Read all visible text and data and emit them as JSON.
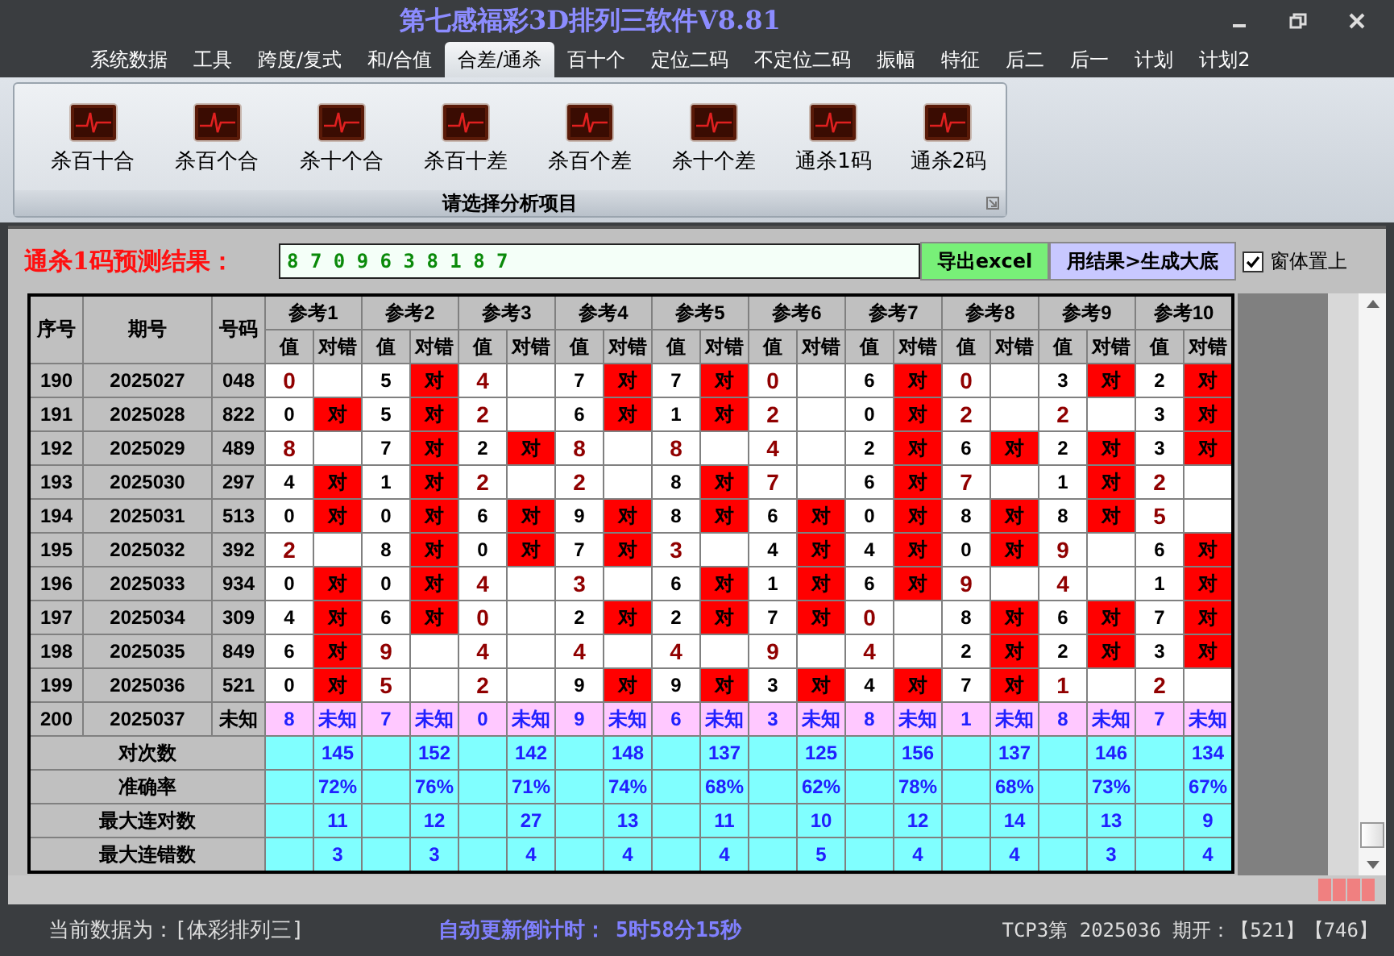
{
  "window": {
    "title": "第七感福彩3D排列三软件V8.81"
  },
  "menu": [
    {
      "label": "系统数据",
      "selected": false
    },
    {
      "label": "工具",
      "selected": false
    },
    {
      "label": "跨度/复式",
      "selected": false
    },
    {
      "label": "和/合值",
      "selected": false
    },
    {
      "label": "合差/通杀",
      "selected": true
    },
    {
      "label": "百十个",
      "selected": false
    },
    {
      "label": "定位二码",
      "selected": false
    },
    {
      "label": "不定位二码",
      "selected": false
    },
    {
      "label": "振幅",
      "selected": false
    },
    {
      "label": "特征",
      "selected": false
    },
    {
      "label": "后二",
      "selected": false
    },
    {
      "label": "后一",
      "selected": false
    },
    {
      "label": "计划",
      "selected": false
    },
    {
      "label": "计划2",
      "selected": false
    }
  ],
  "toolbar": {
    "items": [
      "杀百十合",
      "杀百个合",
      "杀十个合",
      "杀百十差",
      "杀百个差",
      "杀十个差",
      "通杀1码",
      "通杀2码"
    ],
    "caption": "请选择分析项目"
  },
  "prediction": {
    "label": "通杀1码预测结果：",
    "value": "8 7 0 9 6 3 8 1 8 7",
    "export_button": "导出excel",
    "generate_button": "用结果>生成大底",
    "stay_on_top": {
      "label": "窗体置上",
      "checked": true
    }
  },
  "table": {
    "headers": {
      "index": "序号",
      "period": "期号",
      "number": "号码"
    },
    "references": [
      {
        "name": "参考1",
        "value_header": "值",
        "result_header": "对错"
      },
      {
        "name": "参考2",
        "value_header": "值",
        "result_header": "对错"
      },
      {
        "name": "参考3",
        "value_header": "值",
        "result_header": "对错"
      },
      {
        "name": "参考4",
        "value_header": "值",
        "result_header": "对错"
      },
      {
        "name": "参考5",
        "value_header": "值",
        "result_header": "对错"
      },
      {
        "name": "参考6",
        "value_header": "值",
        "result_header": "对错"
      },
      {
        "name": "参考7",
        "value_header": "值",
        "result_header": "对错"
      },
      {
        "name": "参考8",
        "value_header": "值",
        "result_header": "对错"
      },
      {
        "name": "参考9",
        "value_header": "值",
        "result_header": "对错"
      },
      {
        "name": "参考10",
        "value_header": "值",
        "result_header": "对错"
      }
    ],
    "rows": [
      {
        "index": "190",
        "period": "2025027",
        "number": "048",
        "kind": "history",
        "cells": [
          {
            "value": "0"
          },
          {
            "value": "5",
            "result": "对"
          },
          {
            "value": "4"
          },
          {
            "value": "7",
            "result": "对"
          },
          {
            "value": "7",
            "result": "对"
          },
          {
            "value": "0"
          },
          {
            "value": "6",
            "result": "对"
          },
          {
            "value": "0"
          },
          {
            "value": "3",
            "result": "对"
          },
          {
            "value": "2",
            "result": "对"
          }
        ]
      },
      {
        "index": "191",
        "period": "2025028",
        "number": "822",
        "kind": "history",
        "cells": [
          {
            "value": "0",
            "result": "对"
          },
          {
            "value": "5",
            "result": "对"
          },
          {
            "value": "2"
          },
          {
            "value": "6",
            "result": "对"
          },
          {
            "value": "1",
            "result": "对"
          },
          {
            "value": "2"
          },
          {
            "value": "0",
            "result": "对"
          },
          {
            "value": "2"
          },
          {
            "value": "2"
          },
          {
            "value": "3",
            "result": "对"
          }
        ]
      },
      {
        "index": "192",
        "period": "2025029",
        "number": "489",
        "kind": "history",
        "cells": [
          {
            "value": "8"
          },
          {
            "value": "7",
            "result": "对"
          },
          {
            "value": "2",
            "result": "对"
          },
          {
            "value": "8"
          },
          {
            "value": "8"
          },
          {
            "value": "4"
          },
          {
            "value": "2",
            "result": "对"
          },
          {
            "value": "6",
            "result": "对"
          },
          {
            "value": "2",
            "result": "对"
          },
          {
            "value": "3",
            "result": "对"
          }
        ]
      },
      {
        "index": "193",
        "period": "2025030",
        "number": "297",
        "kind": "history",
        "cells": [
          {
            "value": "4",
            "result": "对"
          },
          {
            "value": "1",
            "result": "对"
          },
          {
            "value": "2"
          },
          {
            "value": "2"
          },
          {
            "value": "8",
            "result": "对"
          },
          {
            "value": "7"
          },
          {
            "value": "6",
            "result": "对"
          },
          {
            "value": "7"
          },
          {
            "value": "1",
            "result": "对"
          },
          {
            "value": "2"
          }
        ]
      },
      {
        "index": "194",
        "period": "2025031",
        "number": "513",
        "kind": "history",
        "cells": [
          {
            "value": "0",
            "result": "对"
          },
          {
            "value": "0",
            "result": "对"
          },
          {
            "value": "6",
            "result": "对"
          },
          {
            "value": "9",
            "result": "对"
          },
          {
            "value": "8",
            "result": "对"
          },
          {
            "value": "6",
            "result": "对"
          },
          {
            "value": "0",
            "result": "对"
          },
          {
            "value": "8",
            "result": "对"
          },
          {
            "value": "8",
            "result": "对"
          },
          {
            "value": "5"
          }
        ]
      },
      {
        "index": "195",
        "period": "2025032",
        "number": "392",
        "kind": "history",
        "cells": [
          {
            "value": "2"
          },
          {
            "value": "8",
            "result": "对"
          },
          {
            "value": "0",
            "result": "对"
          },
          {
            "value": "7",
            "result": "对"
          },
          {
            "value": "3"
          },
          {
            "value": "4",
            "result": "对"
          },
          {
            "value": "4",
            "result": "对"
          },
          {
            "value": "0",
            "result": "对"
          },
          {
            "value": "9"
          },
          {
            "value": "6",
            "result": "对"
          }
        ]
      },
      {
        "index": "196",
        "period": "2025033",
        "number": "934",
        "kind": "history",
        "cells": [
          {
            "value": "0",
            "result": "对"
          },
          {
            "value": "0",
            "result": "对"
          },
          {
            "value": "4"
          },
          {
            "value": "3"
          },
          {
            "value": "6",
            "result": "对"
          },
          {
            "value": "1",
            "result": "对"
          },
          {
            "value": "6",
            "result": "对"
          },
          {
            "value": "9"
          },
          {
            "value": "4"
          },
          {
            "value": "1",
            "result": "对"
          }
        ]
      },
      {
        "index": "197",
        "period": "2025034",
        "number": "309",
        "kind": "history",
        "cells": [
          {
            "value": "4",
            "result": "对"
          },
          {
            "value": "6",
            "result": "对"
          },
          {
            "value": "0"
          },
          {
            "value": "2",
            "result": "对"
          },
          {
            "value": "2",
            "result": "对"
          },
          {
            "value": "7",
            "result": "对"
          },
          {
            "value": "0"
          },
          {
            "value": "8",
            "result": "对"
          },
          {
            "value": "6",
            "result": "对"
          },
          {
            "value": "7",
            "result": "对"
          }
        ]
      },
      {
        "index": "198",
        "period": "2025035",
        "number": "849",
        "kind": "history",
        "cells": [
          {
            "value": "6",
            "result": "对"
          },
          {
            "value": "9"
          },
          {
            "value": "4"
          },
          {
            "value": "4"
          },
          {
            "value": "4"
          },
          {
            "value": "9"
          },
          {
            "value": "4"
          },
          {
            "value": "2",
            "result": "对"
          },
          {
            "value": "2",
            "result": "对"
          },
          {
            "value": "3",
            "result": "对"
          }
        ]
      },
      {
        "index": "199",
        "period": "2025036",
        "number": "521",
        "kind": "history",
        "cells": [
          {
            "value": "0",
            "result": "对"
          },
          {
            "value": "5"
          },
          {
            "value": "2"
          },
          {
            "value": "9",
            "result": "对"
          },
          {
            "value": "9",
            "result": "对"
          },
          {
            "value": "3",
            "result": "对"
          },
          {
            "value": "4",
            "result": "对"
          },
          {
            "value": "7",
            "result": "对"
          },
          {
            "value": "1"
          },
          {
            "value": "2"
          }
        ]
      },
      {
        "index": "200",
        "period": "2025037",
        "number": "未知",
        "kind": "pending",
        "cells": [
          {
            "value": "8",
            "result": "未知"
          },
          {
            "value": "7",
            "result": "未知"
          },
          {
            "value": "0",
            "result": "未知"
          },
          {
            "value": "9",
            "result": "未知"
          },
          {
            "value": "6",
            "result": "未知"
          },
          {
            "value": "3",
            "result": "未知"
          },
          {
            "value": "8",
            "result": "未知"
          },
          {
            "value": "1",
            "result": "未知"
          },
          {
            "value": "8",
            "result": "未知"
          },
          {
            "value": "7",
            "result": "未知"
          }
        ]
      }
    ],
    "stats": [
      {
        "label": "对次数",
        "values": [
          "145",
          "152",
          "142",
          "148",
          "137",
          "125",
          "156",
          "137",
          "146",
          "134"
        ]
      },
      {
        "label": "准确率",
        "values": [
          "72%",
          "76%",
          "71%",
          "74%",
          "68%",
          "62%",
          "78%",
          "68%",
          "73%",
          "67%"
        ]
      },
      {
        "label": "最大连对数",
        "values": [
          "11",
          "12",
          "27",
          "13",
          "11",
          "10",
          "12",
          "14",
          "13",
          "9"
        ]
      },
      {
        "label": "最大连错数",
        "values": [
          "3",
          "3",
          "4",
          "4",
          "4",
          "5",
          "4",
          "4",
          "3",
          "4"
        ]
      }
    ]
  },
  "status_bar": {
    "data_source": "当前数据为：[体彩排列三]",
    "countdown_label": "自动更新倒计时：",
    "countdown": "5时58分15秒",
    "draw_info": "TCP3第 2025036 期开：【521】【746】"
  }
}
